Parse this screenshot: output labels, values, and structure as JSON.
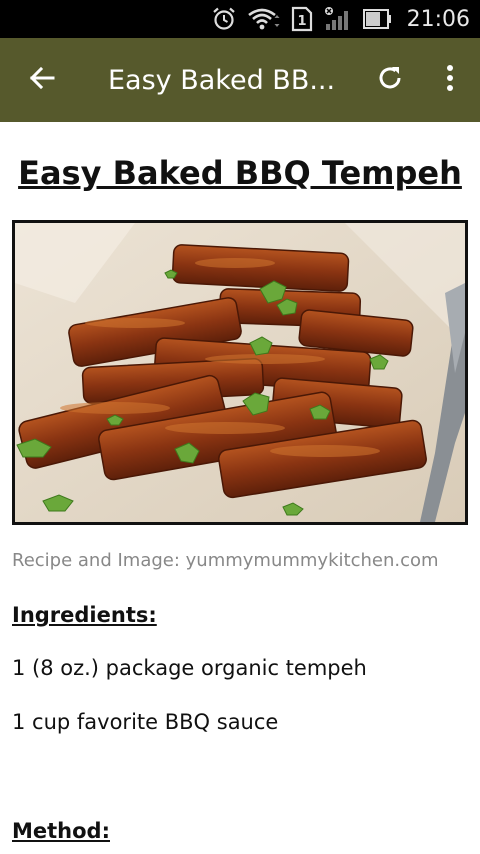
{
  "status_bar": {
    "time": "21:06",
    "sim_label": "1",
    "icons": [
      "alarm-icon",
      "wifi-icon",
      "sim-icon",
      "signal-icon",
      "battery-icon"
    ]
  },
  "app_bar": {
    "title": "Easy Baked BB...",
    "icons": [
      "back-arrow-icon",
      "refresh-icon",
      "more-vert-icon"
    ],
    "background_color": "#56592c"
  },
  "recipe": {
    "title": "Easy Baked BBQ Tempeh",
    "credit": "Recipe and Image: yummymummykitchen.com",
    "ingredients_heading": "Ingredients:",
    "ingredients": [
      "1 (8 oz.) package organic tempeh",
      "1 cup favorite BBQ sauce"
    ],
    "method_heading": "Method:"
  }
}
